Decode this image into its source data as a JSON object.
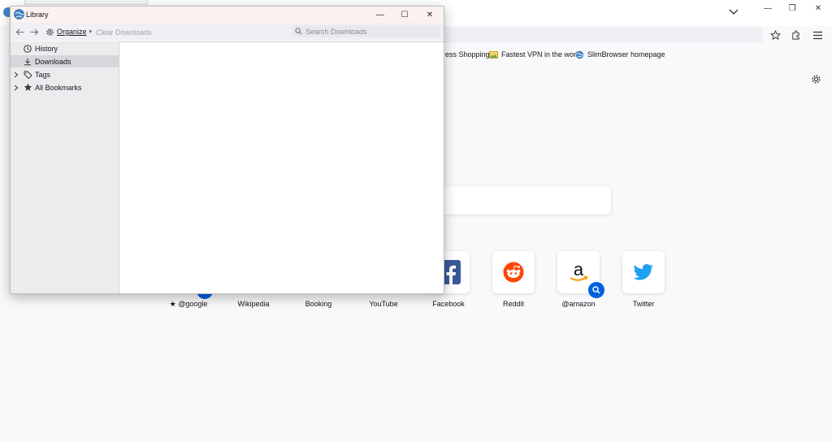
{
  "browser": {
    "window_controls": {
      "minimize": "—",
      "maximize": "❐",
      "close": "✕"
    },
    "bookmarks_bar": [
      {
        "label": "ress Shopping",
        "icon": "none"
      },
      {
        "label": "Fastest VPN in the world",
        "icon": "folder-image-icon"
      },
      {
        "label": "SlimBrowser homepage",
        "icon": "slimbrowser-globe-icon"
      }
    ],
    "top_sites": [
      {
        "label": "★ @google",
        "icon": "google-icon"
      },
      {
        "label": "Wikipedia",
        "icon": "wikipedia-icon"
      },
      {
        "label": "Booking",
        "icon": "booking-icon"
      },
      {
        "label": "YouTube",
        "icon": "youtube-icon"
      },
      {
        "label": "Facebook",
        "icon": "facebook-icon",
        "color": "#3b5998"
      },
      {
        "label": "Reddit",
        "icon": "reddit-icon",
        "color": "#ff4500"
      },
      {
        "label": "@amazon",
        "icon": "amazon-icon",
        "color": "#0060df"
      },
      {
        "label": "Twitter",
        "icon": "twitter-icon",
        "color": "#1da1f2"
      }
    ]
  },
  "library": {
    "title": "Library",
    "window_controls": {
      "minimize": "—",
      "maximize": "☐",
      "close": "✕"
    },
    "toolbar": {
      "organize_label": "Organize",
      "organize_caret": "▾",
      "clear_downloads_label": "Clear Downloads",
      "search_placeholder": "Search Downloads"
    },
    "sidebar": [
      {
        "label": "History",
        "icon": "clock-icon",
        "expandable": false,
        "selected": false
      },
      {
        "label": "Downloads",
        "icon": "download-icon",
        "expandable": false,
        "selected": true
      },
      {
        "label": "Tags",
        "icon": "tag-icon",
        "expandable": true,
        "selected": false
      },
      {
        "label": "All Bookmarks",
        "icon": "star-icon",
        "expandable": true,
        "selected": false
      }
    ]
  },
  "colors": {
    "accent": "#0060df",
    "selected_bg": "#d7d7db",
    "titlebar_bg": "#fbf1ef"
  }
}
